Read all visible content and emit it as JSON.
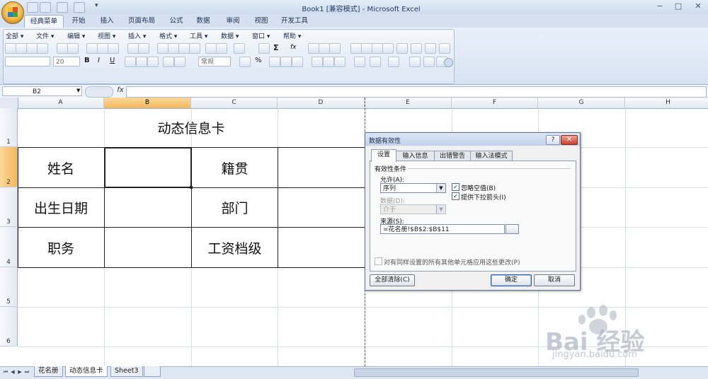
{
  "window": {
    "title": "Book1  [兼容模式] - Microsoft Excel",
    "min": "−",
    "max": "□",
    "close": "✕"
  },
  "qat": {
    "more": "▾"
  },
  "ribbon_tabs": [
    "经典菜单",
    "开始",
    "插入",
    "页面布局",
    "公式",
    "数据",
    "审阅",
    "视图",
    "开发工具"
  ],
  "classic_menu": [
    "全部 ▾",
    "文件 ▾",
    "编辑 ▾",
    "视图 ▾",
    "插入 ▾",
    "格式 ▾",
    "工具 ▾",
    "数据 ▾",
    "窗口 ▾",
    "帮助 ▾"
  ],
  "toolbar": {
    "font_size": "20",
    "number_format": "常规",
    "bold": "B",
    "italic": "I",
    "underline": "U",
    "sum": "Σ",
    "fx": "fx",
    "percent": "%"
  },
  "formula_bar": {
    "name_box": "B2",
    "fx": "fx",
    "formula": ""
  },
  "columns": [
    "A",
    "B",
    "C",
    "D",
    "E",
    "F",
    "G",
    "H"
  ],
  "rows": [
    "1",
    "2",
    "3",
    "4",
    "5",
    "6"
  ],
  "sheet": {
    "title": "动态信息卡",
    "cells": {
      "a2": "姓名",
      "c2": "籍贯",
      "a3": "出生日期",
      "c3": "部门",
      "a4": "职务",
      "c4": "工资档级"
    }
  },
  "sheet_tabs": [
    "花名册",
    "动态信息卡",
    "Sheet3"
  ],
  "dialog": {
    "title": "数据有效性",
    "help": "?",
    "close": "✕",
    "tabs": [
      "设置",
      "输入信息",
      "出错警告",
      "输入法模式"
    ],
    "group_label": "有效性条件",
    "allow_label": "允许(A):",
    "allow_value": "序列",
    "data_label": "数据(D):",
    "data_value": "介于",
    "ignore_blank": "忽略空值(B)",
    "dropdown": "提供下拉箭头(I)",
    "source_label": "来源(S):",
    "source_value": "=花名册!$B$2:$B$11",
    "apply_all": "对有同样设置的所有其他单元格应用这些更改(P)",
    "clear_all": "全部清除(C)",
    "ok": "确定",
    "cancel": "取消"
  },
  "watermark": {
    "brand": "Bai 经验",
    "url": "jingyan.baidu.com"
  }
}
